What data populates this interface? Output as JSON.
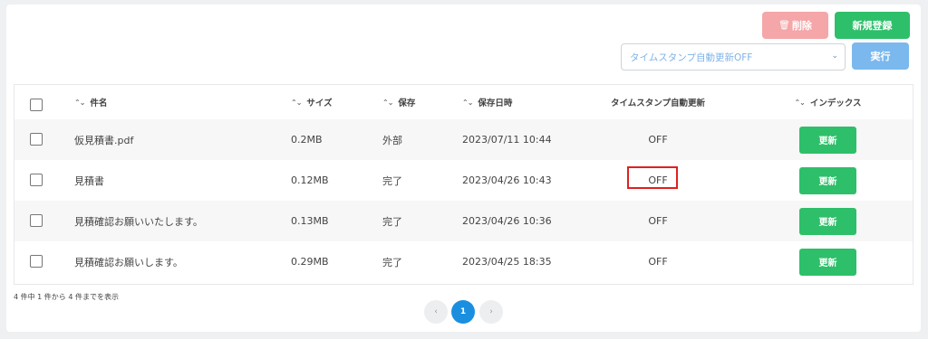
{
  "toolbar": {
    "delete_icon": "🗑",
    "delete_label": "削除",
    "new_label": "新規登録",
    "select_value": "タイムスタンプ自動更新OFF",
    "caret": "⌄",
    "run_label": "実行"
  },
  "table": {
    "sort_glyph": "⌃⌄",
    "headers": {
      "name": "件名",
      "size": "サイズ",
      "store": "保存",
      "date": "保存日時",
      "timestamp": "タイムスタンプ自動更新",
      "index": "インデックス"
    },
    "rows": [
      {
        "name": "仮見積書.pdf",
        "size": "0.2MB",
        "store": "外部",
        "date": "2023/07/11 10:44",
        "timestamp": "OFF",
        "action": "更新"
      },
      {
        "name": "見積書",
        "size": "0.12MB",
        "store": "完了",
        "date": "2023/04/26 10:43",
        "timestamp": "OFF",
        "action": "更新"
      },
      {
        "name": "見積確認お願いいたします。",
        "size": "0.13MB",
        "store": "完了",
        "date": "2023/04/26 10:36",
        "timestamp": "OFF",
        "action": "更新"
      },
      {
        "name": "見積確認お願いします。",
        "size": "0.29MB",
        "store": "完了",
        "date": "2023/04/25 18:35",
        "timestamp": "OFF",
        "action": "更新"
      }
    ]
  },
  "footer": {
    "summary": "4 件中 1 件から 4 件までを表示",
    "prev": "‹",
    "current_page": "1",
    "next": "›"
  },
  "colors": {
    "green": "#2ebf6a",
    "delete_pink": "#f4a6a8",
    "run_blue": "#7ab8ee",
    "page_blue": "#1a8fe0",
    "highlight_red": "#e02020"
  }
}
